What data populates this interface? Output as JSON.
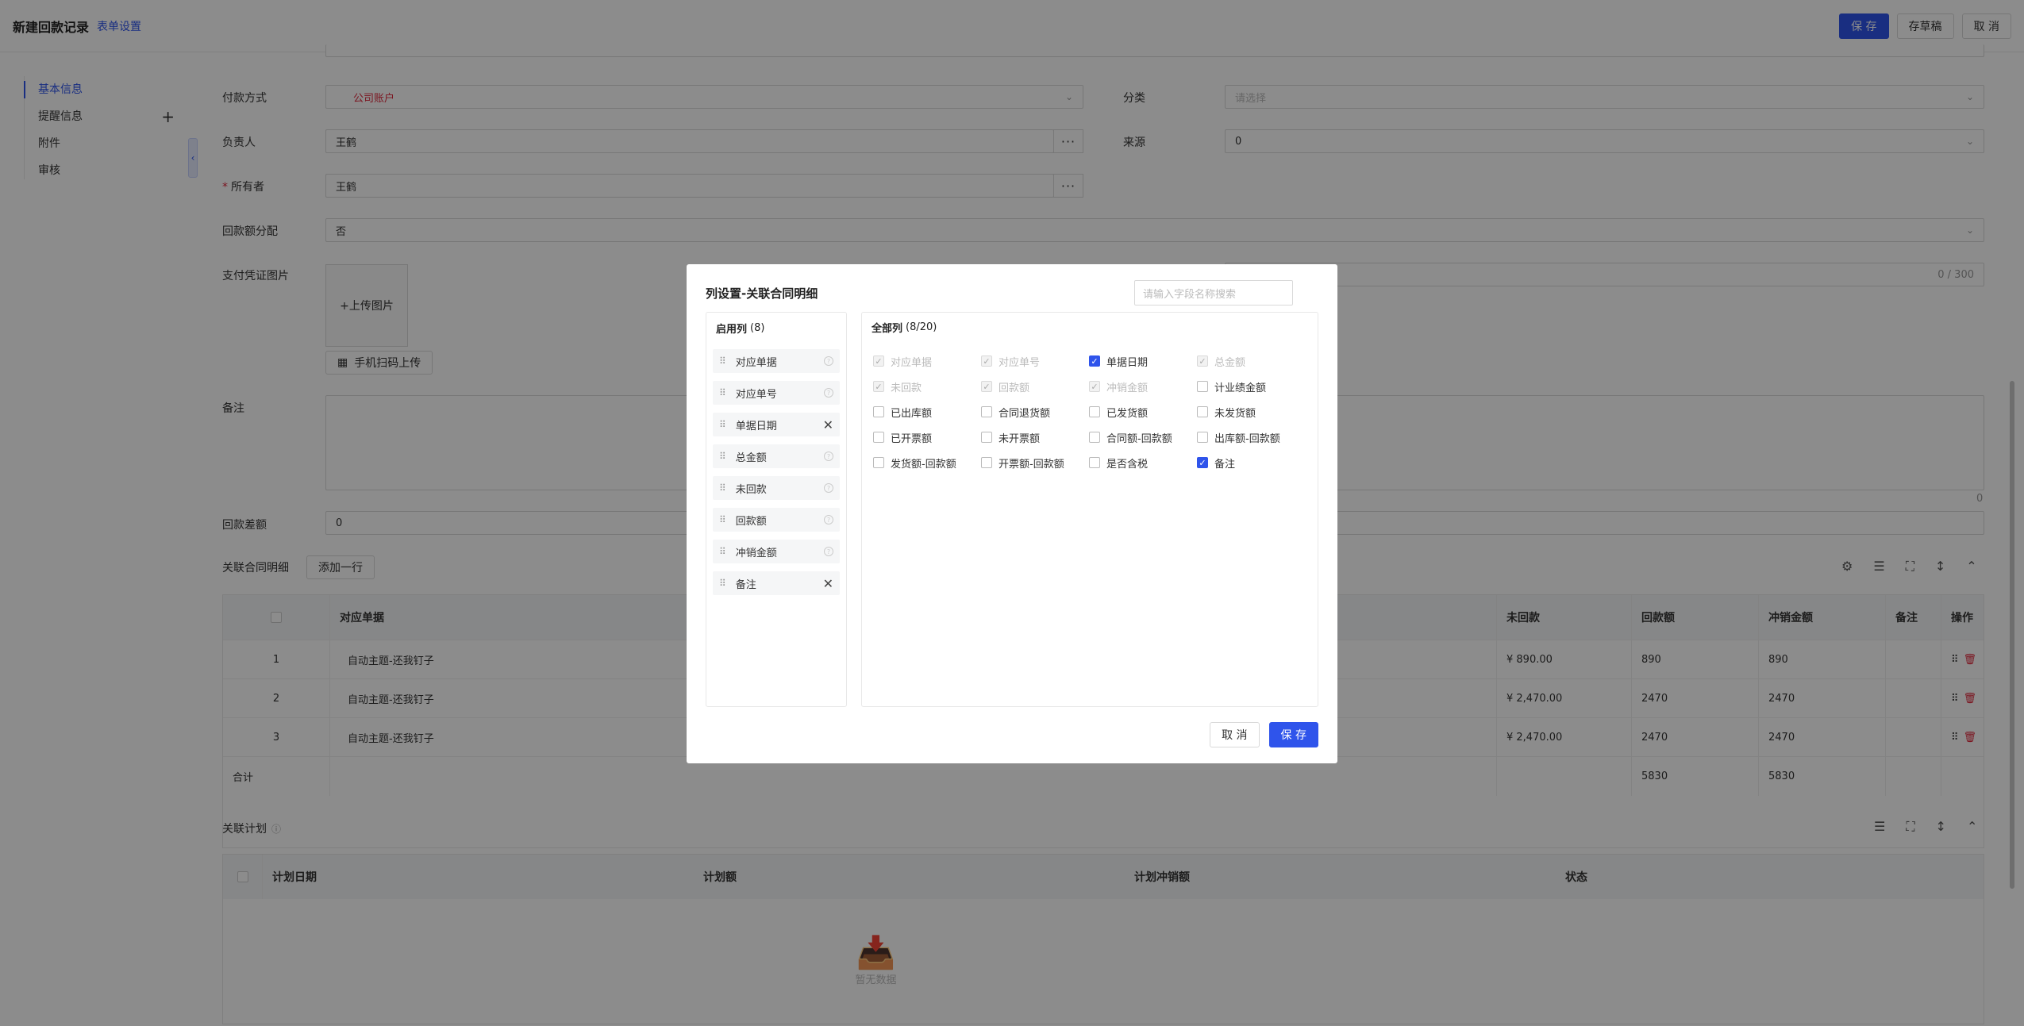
{
  "header": {
    "title": "新建回款记录",
    "settings_link": "表单设置",
    "save": "保 存",
    "draft": "存草稿",
    "cancel": "取 消"
  },
  "sidebar": {
    "items": [
      {
        "label": "基本信息"
      },
      {
        "label": "提醒信息",
        "plus": "+"
      },
      {
        "label": "附件"
      },
      {
        "label": "审核"
      }
    ]
  },
  "form": {
    "payment_method": {
      "label": "付款方式",
      "value": "公司账户"
    },
    "category": {
      "label": "分类",
      "placeholder": "请选择"
    },
    "owner_person": {
      "label": "负责人",
      "value": "王鹤"
    },
    "source": {
      "label": "来源",
      "value": "0"
    },
    "owner": {
      "label": "所有者",
      "value": "王鹤",
      "required": "*"
    },
    "allocation": {
      "label": "回款额分配",
      "value": "否"
    },
    "voucher": {
      "label": "支付凭证图片",
      "upload": "+上传图片",
      "scan": "手机扫码上传",
      "counter": "0 / 300"
    },
    "remark": {
      "label": "备注",
      "counter": "0"
    },
    "diff": {
      "label": "回款差额",
      "value": "0"
    }
  },
  "contract_section": {
    "title": "关联合同明细",
    "add_row": "添加一行"
  },
  "contract_table": {
    "headers": [
      "对应单据",
      "未回款",
      "回款额",
      "冲销金额",
      "备注",
      "操作"
    ],
    "rows": [
      {
        "no": "1",
        "doc": "自动主题-还我钉子",
        "unpaid": "¥ 890.00",
        "paid": "890",
        "offset": "890"
      },
      {
        "no": "2",
        "doc": "自动主题-还我钉子",
        "unpaid": "¥ 2,470.00",
        "paid": "2470",
        "offset": "2470"
      },
      {
        "no": "3",
        "doc": "自动主题-还我钉子",
        "unpaid": "¥ 2,470.00",
        "paid": "2470",
        "offset": "2470"
      }
    ],
    "total": {
      "label": "合计",
      "paid": "5830",
      "offset": "5830"
    }
  },
  "plan_section": {
    "title": "关联计划"
  },
  "plan_table": {
    "headers": [
      "计划日期",
      "计划额",
      "计划冲销额",
      "状态"
    ],
    "empty": "暂无数据"
  },
  "modal": {
    "title": "列设置-关联合同明细",
    "search_placeholder": "请输入字段名称搜索",
    "enabled": {
      "title": "启用列",
      "count": "(8)",
      "items": [
        {
          "label": "对应单据",
          "removable": false
        },
        {
          "label": "对应单号",
          "removable": false
        },
        {
          "label": "单据日期",
          "removable": true
        },
        {
          "label": "总金额",
          "removable": false
        },
        {
          "label": "未回款",
          "removable": false
        },
        {
          "label": "回款额",
          "removable": false
        },
        {
          "label": "冲销金额",
          "removable": false
        },
        {
          "label": "备注",
          "removable": true
        }
      ]
    },
    "all": {
      "title": "全部列",
      "count": "(8/20)",
      "options": [
        {
          "label": "对应单据",
          "state": "disabled"
        },
        {
          "label": "对应单号",
          "state": "disabled"
        },
        {
          "label": "单据日期",
          "state": "checked"
        },
        {
          "label": "总金额",
          "state": "disabled"
        },
        {
          "label": "未回款",
          "state": "disabled"
        },
        {
          "label": "回款额",
          "state": "disabled"
        },
        {
          "label": "冲销金额",
          "state": "disabled"
        },
        {
          "label": "计业绩金额",
          "state": "unchecked"
        },
        {
          "label": "已出库额",
          "state": "unchecked"
        },
        {
          "label": "合同退货额",
          "state": "unchecked"
        },
        {
          "label": "已发货额",
          "state": "unchecked"
        },
        {
          "label": "未发货额",
          "state": "unchecked"
        },
        {
          "label": "已开票额",
          "state": "unchecked"
        },
        {
          "label": "未开票额",
          "state": "unchecked"
        },
        {
          "label": "合同额-回款额",
          "state": "unchecked"
        },
        {
          "label": "出库额-回款额",
          "state": "unchecked"
        },
        {
          "label": "发货额-回款额",
          "state": "unchecked"
        },
        {
          "label": "开票额-回款额",
          "state": "unchecked"
        },
        {
          "label": "是否含税",
          "state": "unchecked"
        },
        {
          "label": "备注",
          "state": "checked"
        }
      ]
    },
    "cancel": "取 消",
    "save": "保 存"
  },
  "colors": {
    "primary": "#2f54eb",
    "danger": "#e0283c"
  }
}
